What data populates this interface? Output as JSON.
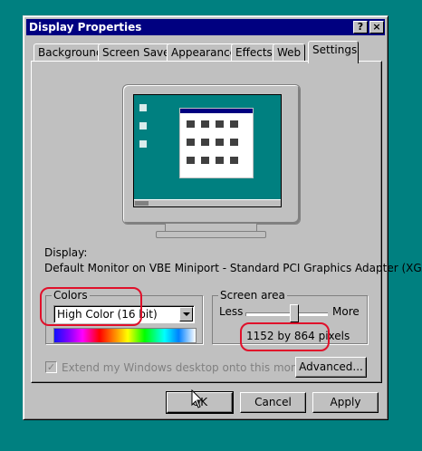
{
  "window": {
    "title": "Display Properties",
    "help_glyph": "?",
    "close_glyph": "×"
  },
  "tabs": [
    {
      "label": "Background"
    },
    {
      "label": "Screen Saver"
    },
    {
      "label": "Appearance"
    },
    {
      "label": "Effects"
    },
    {
      "label": "Web"
    },
    {
      "label": "Settings",
      "active": true
    }
  ],
  "display": {
    "label": "Display:",
    "value": "Default Monitor on VBE Miniport - Standard PCI Graphics Adapter (XGA)"
  },
  "colors": {
    "group_label": "Colors",
    "selected": "High Color (16 bit)"
  },
  "screen_area": {
    "group_label": "Screen area",
    "less_label": "Less",
    "more_label": "More",
    "value_text": "1152 by 864 pixels",
    "slider_level_fraction": 0.6
  },
  "extend_checkbox": {
    "label": "Extend my Windows desktop onto this monitor.",
    "checked": true,
    "disabled": true,
    "glyph": "✓"
  },
  "buttons": {
    "advanced": "Advanced...",
    "ok": "OK",
    "cancel": "Cancel",
    "apply": "Apply"
  },
  "colors_palette": {
    "desktop": "#008080",
    "title_bar": "#000080",
    "face": "#c0c0c0",
    "annotation": "#e0102a"
  }
}
